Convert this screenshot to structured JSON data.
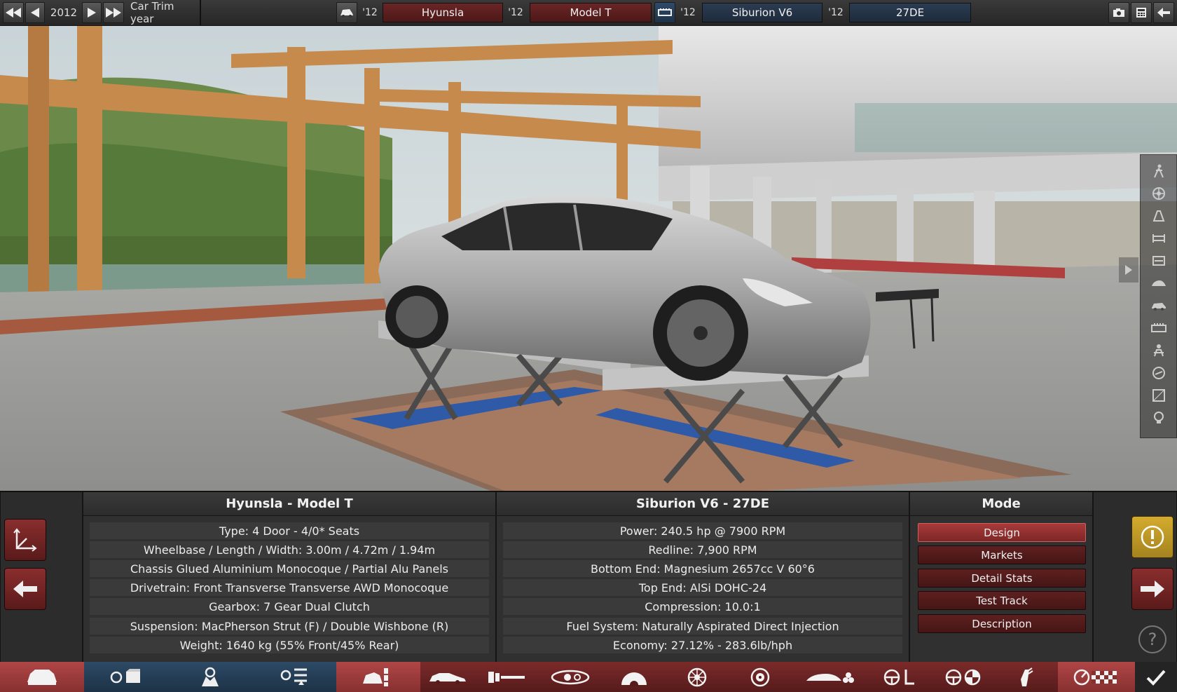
{
  "topbar": {
    "year": "2012",
    "title": "Car Trim year",
    "car_year_tag": "'12",
    "car_make": "Hyunsla",
    "model_year_tag": "'12",
    "model": "Model T",
    "engine_year_tag": "'12",
    "engine_family": "Siburion V6",
    "variant_year_tag": "'12",
    "engine_variant": "27DE",
    "icons": [
      "rewind-fast-icon",
      "rewind-icon",
      "play-icon",
      "fast-forward-icon",
      "car-icon",
      "engine-icon",
      "camera-icon",
      "calculator-icon",
      "back-arrow-icon"
    ]
  },
  "side_toolbar": {
    "icons": [
      "person-icon",
      "wheel-icon",
      "chassis-icon",
      "drivetrain-icon",
      "suspension-icon",
      "body-icon",
      "car-side-icon",
      "engine-block-icon",
      "passenger-icon",
      "gauge-icon",
      "panel-icon",
      "lightbulb-icon"
    ]
  },
  "car_panel": {
    "title": "Hyunsla - Model T",
    "stats": [
      "Type: 4 Door - 4/0* Seats",
      "Wheelbase / Length / Width: 3.00m / 4.72m / 1.94m",
      "Chassis Glued Aluminium Monocoque / Partial Alu Panels",
      "Drivetrain: Front Transverse Transverse AWD Monocoque",
      "Gearbox: 7 Gear Dual Clutch",
      "Suspension: MacPherson Strut (F) / Double Wishbone (R)",
      "Weight: 1640 kg (55% Front/45% Rear)"
    ]
  },
  "engine_panel": {
    "title": "Siburion V6 - 27DE",
    "stats": [
      "Power: 240.5 hp @ 7900 RPM",
      "Redline:  7,900 RPM",
      "Bottom End: Magnesium 2657cc V 60°6",
      "Top End: AlSi DOHC-24",
      "Compression: 10.0:1",
      "Fuel System: Naturally Aspirated Direct Injection",
      "Economy: 27.12% - 283.6lb/hph"
    ]
  },
  "mode_panel": {
    "title": "Mode",
    "buttons": [
      "Design",
      "Markets",
      "Detail Stats",
      "Test Track",
      "Description"
    ],
    "active": "Design"
  },
  "help_glyph": "?",
  "bottom_tabs": [
    "car-body-icon",
    "engine-family-icon",
    "engine-block-icon",
    "engine-variant-icon",
    "trim-design-icon",
    "chassis-icon",
    "suspension-icon",
    "lights-icon",
    "gearbox-icon",
    "wheels-icon",
    "brakes-icon",
    "aero-icon",
    "interior-icon",
    "safety-icon",
    "fuel-icon",
    "tune-icon",
    "checkmark-icon"
  ],
  "colors": {
    "accent_red": "#a83a3a",
    "tab_blue": "#2d4a66",
    "warning_yellow": "#c9a227"
  }
}
